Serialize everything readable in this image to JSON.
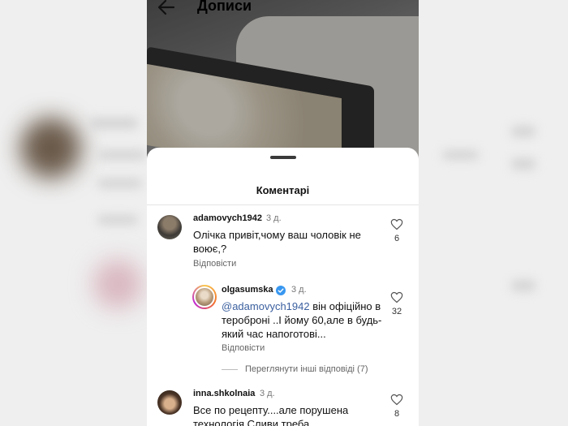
{
  "header": {
    "title": "Дописи"
  },
  "sheet": {
    "title": "Коментарі"
  },
  "comments": [
    {
      "username": "adamovych1942",
      "time": "3 д.",
      "text": "Олічка привіт,чому ваш чоловік не воює,?",
      "reply_label": "Відповісти",
      "likes": "6"
    },
    {
      "username": "olgasumska",
      "time": "3 д.",
      "mention": "@adamovych1942",
      "text": " він офіційно в тероброні ..І йому 60,але в будь-який час напоготові...",
      "reply_label": "Відповісти",
      "likes": "32"
    },
    {
      "username": "inna.shkolnaia",
      "time": "3 д.",
      "text": "Все по рецепту....але порушена технологія.Сливи треба",
      "likes": "8"
    }
  ],
  "thread": {
    "view_more": "Переглянути інші відповіді (7)"
  },
  "colors": {
    "mention": "#3a5f9f",
    "verified": "#3897f0"
  },
  "icons": [
    "back-arrow-icon",
    "heart-icon",
    "verified-badge-icon"
  ]
}
